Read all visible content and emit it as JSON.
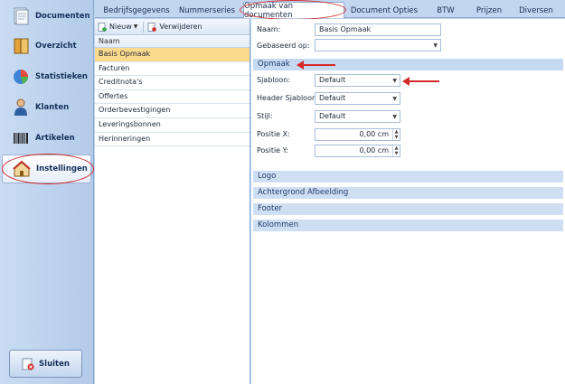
{
  "sidebar": {
    "items": [
      {
        "label": "Documenten",
        "icon": "documents-icon"
      },
      {
        "label": "Overzicht",
        "icon": "overview-icon"
      },
      {
        "label": "Statistieken",
        "icon": "statistics-icon"
      },
      {
        "label": "Klanten",
        "icon": "customers-icon"
      },
      {
        "label": "Artikelen",
        "icon": "barcode-icon"
      },
      {
        "label": "Instellingen",
        "icon": "settings-icon"
      }
    ],
    "active_index": 5,
    "close_label": "Sluiten"
  },
  "tabs": [
    {
      "label": "Bedrijfsgegevens"
    },
    {
      "label": "Nummerseries"
    },
    {
      "label": "Opmaak van documenten"
    },
    {
      "label": "Document Opties"
    },
    {
      "label": "BTW"
    },
    {
      "label": "Prijzen"
    },
    {
      "label": "Diversen"
    }
  ],
  "active_tab": 2,
  "list": {
    "toolbar": {
      "new_label": "Nieuw",
      "delete_label": "Verwijderen"
    },
    "header": "Naam",
    "rows": [
      "Basis Opmaak",
      "Facturen",
      "Creditnota's",
      "Offertes",
      "Orderbevestigingen",
      "Leveringsbonnen",
      "Herinneringen"
    ],
    "selected_index": 0
  },
  "form": {
    "name_label": "Naam:",
    "name_value": "Basis Opmaak",
    "based_on_label": "Gebaseerd op:",
    "based_on_value": "",
    "section_opmaak": "Opmaak",
    "sjabloon_label": "Sjabloon:",
    "sjabloon_value": "Default",
    "header_sjabloon_label": "Header Sjabloon:",
    "header_sjabloon_value": "Default",
    "stijl_label": "Stijl:",
    "stijl_value": "Default",
    "positie_x_label": "Positie X:",
    "positie_x_value": "0,00 cm",
    "positie_y_label": "Positie Y:",
    "positie_y_value": "0,00 cm",
    "collapsed_sections": [
      "Logo",
      "Achtergrond Afbeelding",
      "Footer",
      "Kolommen"
    ]
  },
  "colors": {
    "annotation": "#d42a2a",
    "selection": "#fbd98d",
    "section": "#cfdff3"
  }
}
